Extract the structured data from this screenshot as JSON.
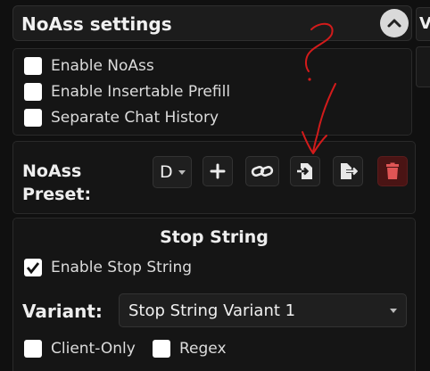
{
  "header": {
    "title": "NoAss settings",
    "side_tab": "V"
  },
  "options": [
    {
      "label": "Enable NoAss",
      "checked": false
    },
    {
      "label": "Enable Insertable Prefill",
      "checked": false
    },
    {
      "label": "Separate Chat History",
      "checked": false
    }
  ],
  "preset": {
    "label": "NoAss Preset:",
    "selected": "D",
    "buttons": [
      "plus-icon",
      "link-icon",
      "file-import-icon",
      "file-export-icon",
      "trash-icon"
    ]
  },
  "stop_string": {
    "title": "Stop String",
    "enable_label": "Enable Stop String",
    "enable_checked": true,
    "variant_label": "Variant:",
    "variant_value": "Stop String Variant 1",
    "client_only_label": "Client-Only",
    "regex_label": "Regex"
  },
  "annotation": {
    "text": "?",
    "color": "#d21b1b"
  }
}
